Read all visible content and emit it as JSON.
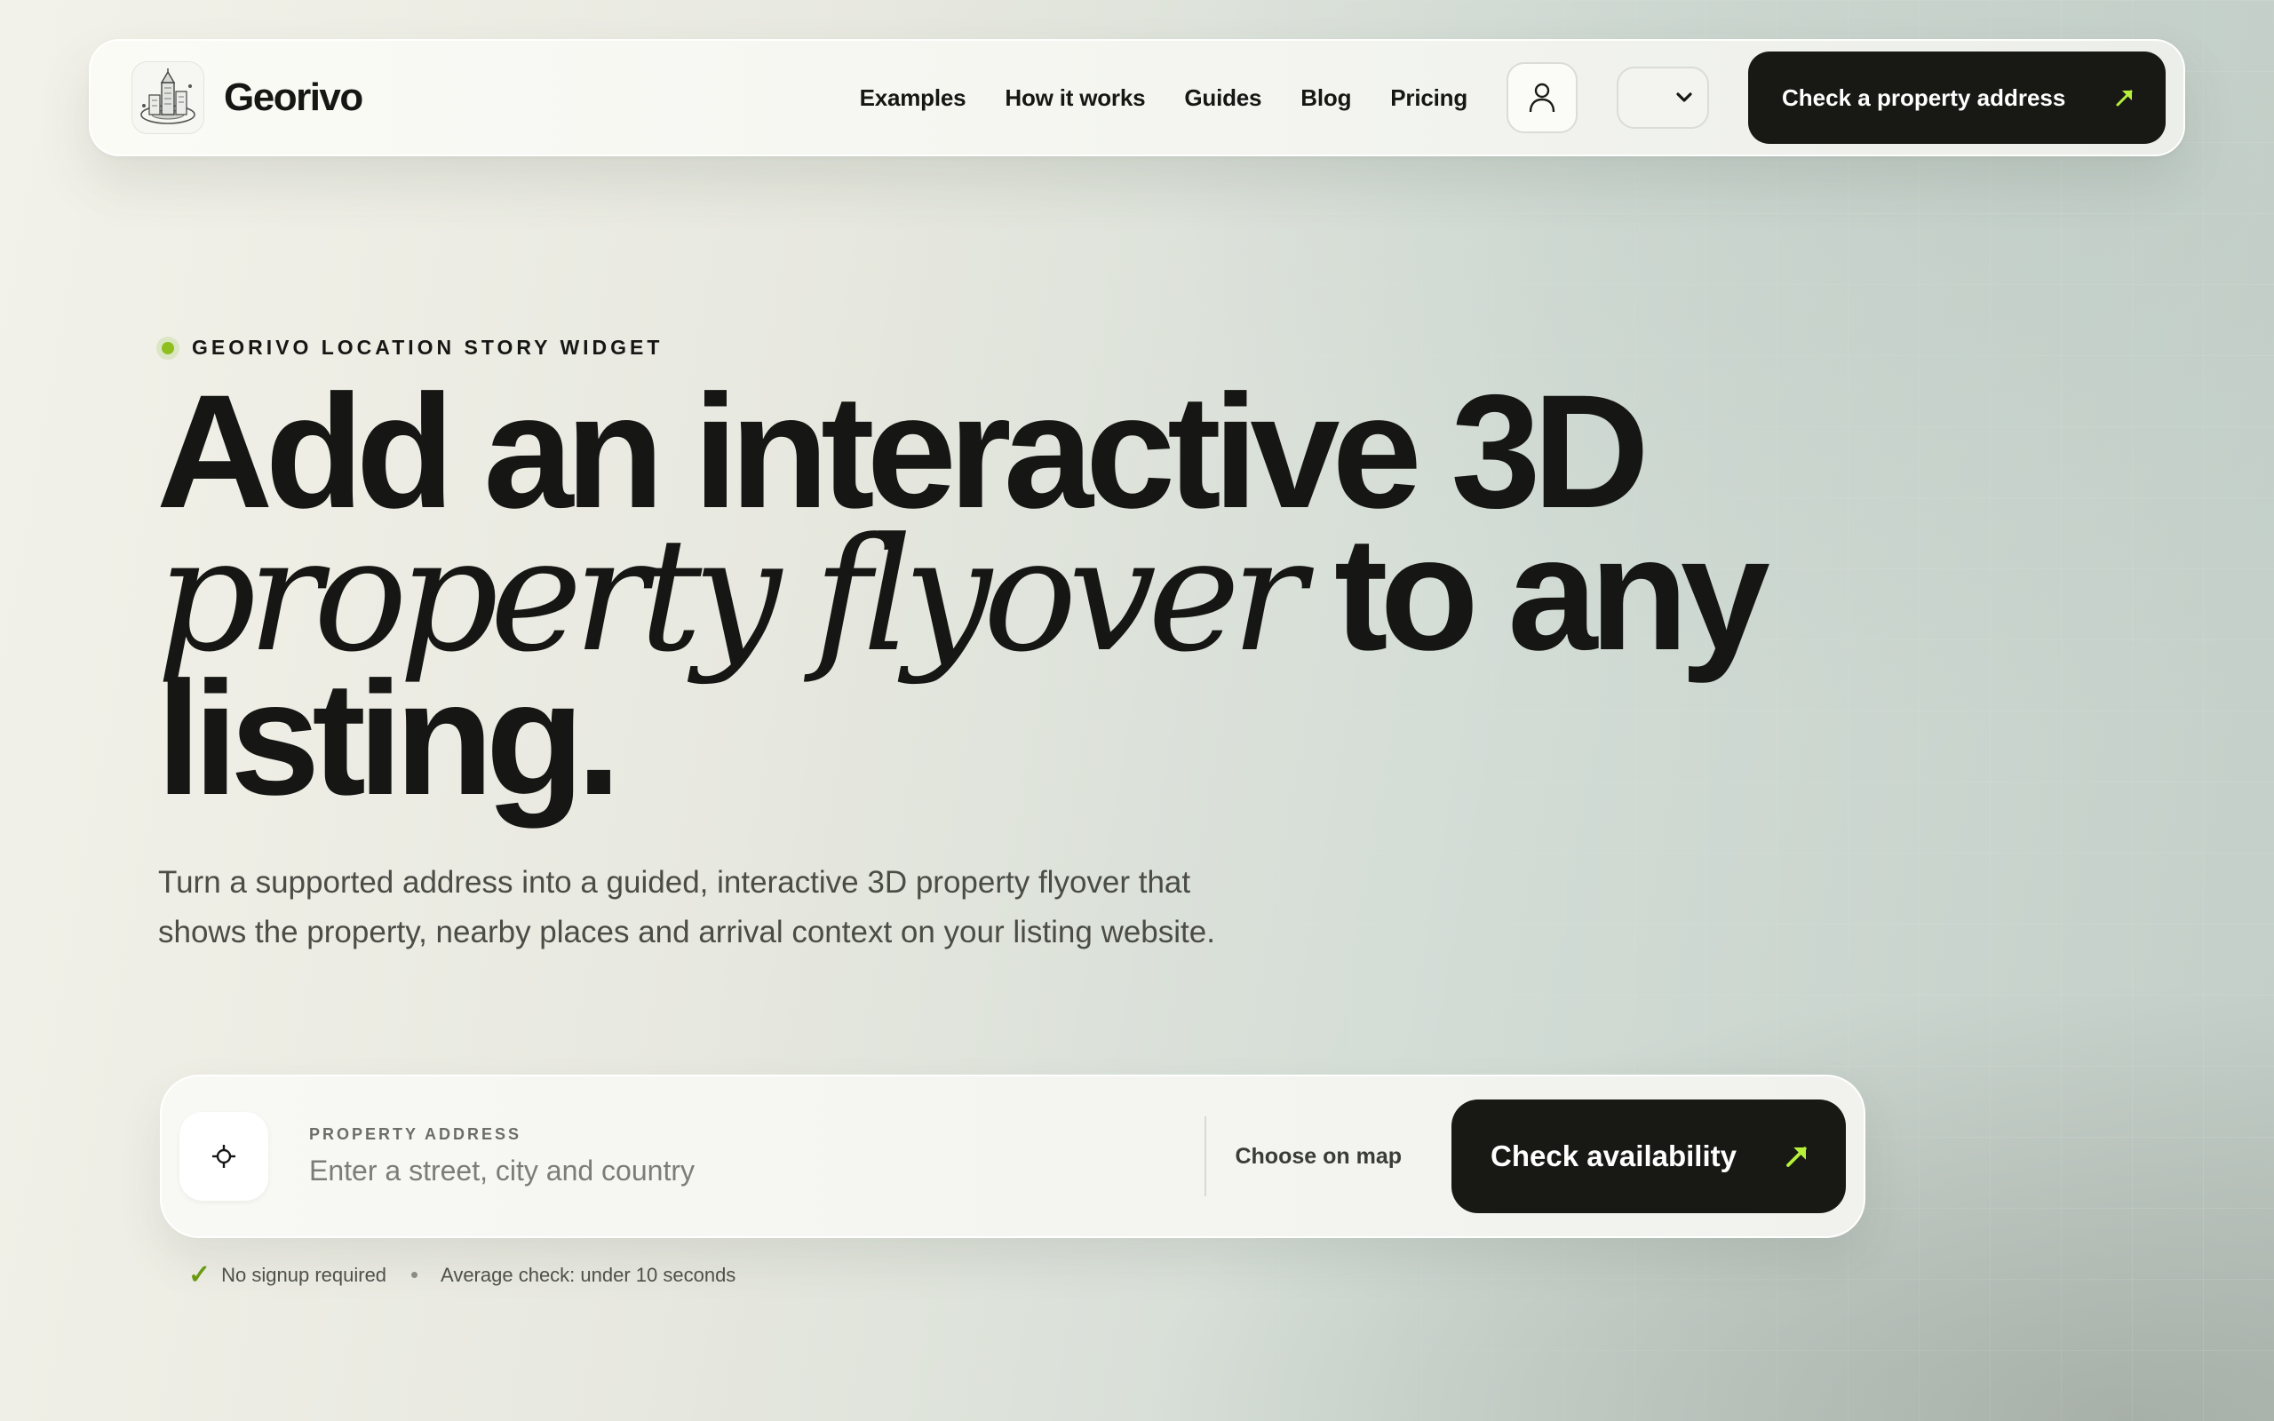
{
  "brand": {
    "name": "Georivo",
    "logo_icon": "city-tower-logo-icon"
  },
  "nav": {
    "links": [
      "Examples",
      "How it works",
      "Guides",
      "Blog",
      "Pricing"
    ],
    "account_icon": "user-icon",
    "language_icon": "chevron-down-icon",
    "cta_label": "Check a property address",
    "cta_icon": "arrow-up-right-icon"
  },
  "hero": {
    "eyebrow": "GEORIVO LOCATION STORY WIDGET",
    "headline_line1": "Add an interactive 3D",
    "headline_serif": "property flyover",
    "headline_line2_rest": "to any",
    "headline_line3": "listing.",
    "subtext": "Turn a supported address into a guided, interactive 3D property flyover that shows the property, nearby places and arrival context on your listing website."
  },
  "search": {
    "label": "PROPERTY ADDRESS",
    "placeholder": "Enter a street, city and country",
    "value": "",
    "locate_icon": "crosshair-icon",
    "map_link": "Choose on map",
    "submit_label": "Check availability",
    "submit_icon": "arrow-up-right-icon"
  },
  "meta": {
    "item1": "No signup required",
    "item2": "Average check: under 10 seconds"
  },
  "colors": {
    "accent": "#a6e22e",
    "dark": "#181915",
    "eyebrow_dot": "#8fbe1f",
    "check": "#6b9a12"
  }
}
